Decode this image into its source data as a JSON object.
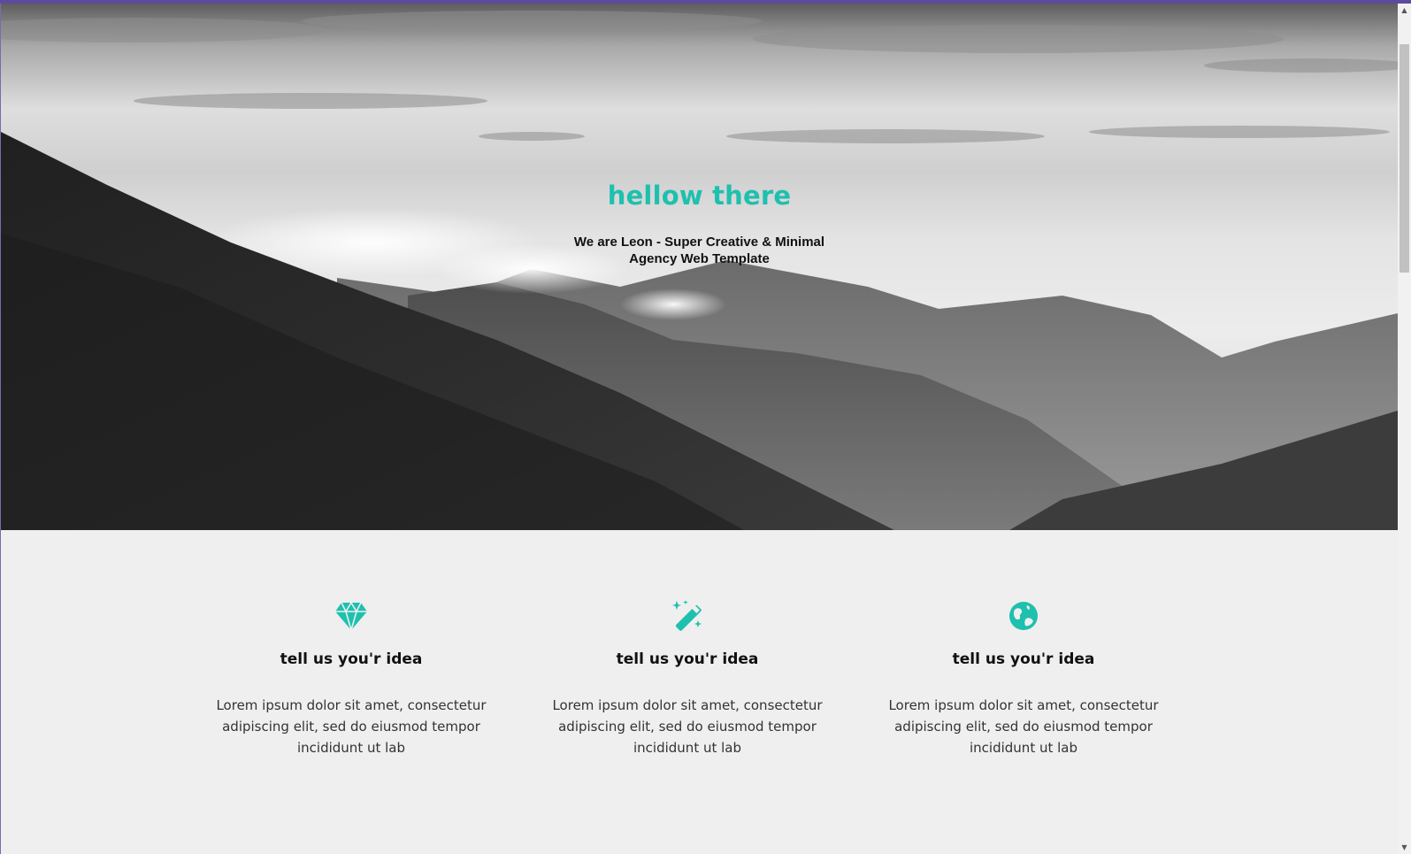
{
  "colors": {
    "accent": "#1ec0ae",
    "top_bar": "#5b4a9e",
    "page_background": "#efefef"
  },
  "hero": {
    "title": "hellow there",
    "subtitle": "We are Leon - Super Creative & Minimal Agency Web Template",
    "background_image": "black-and-white mountain landscape with clouds"
  },
  "features": [
    {
      "icon": "diamond-icon",
      "title": "tell us you'r idea",
      "text": "Lorem ipsum dolor sit amet, consectetur adipiscing elit, sed do eiusmod tempor incididunt ut lab"
    },
    {
      "icon": "magic-wand-icon",
      "title": "tell us you'r idea",
      "text": "Lorem ipsum dolor sit amet, consectetur adipiscing elit, sed do eiusmod tempor incididunt ut lab"
    },
    {
      "icon": "globe-icon",
      "title": "tell us you'r idea",
      "text": "Lorem ipsum dolor sit amet, consectetur adipiscing elit, sed do eiusmod tempor incididunt ut lab"
    }
  ]
}
